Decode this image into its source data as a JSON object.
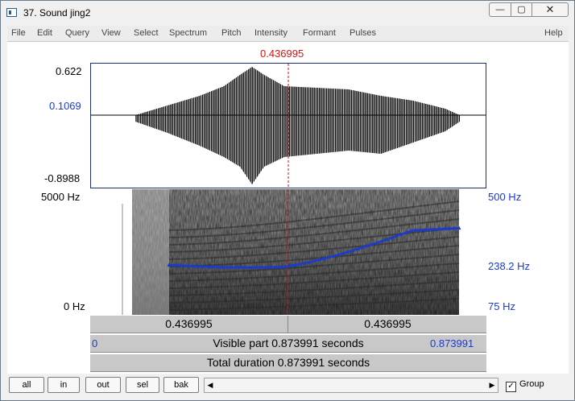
{
  "window": {
    "title": "37. Sound jing2",
    "min_glyph": "—",
    "max_glyph": "▢",
    "close_glyph": "✕"
  },
  "menu": [
    "File",
    "Edit",
    "Query",
    "View",
    "Select",
    "Spectrum",
    "Pitch",
    "Intensity",
    "Formant",
    "Pulses"
  ],
  "menu_help": "Help",
  "cursor": {
    "time": "0.436995"
  },
  "waveform": {
    "max": "0.622",
    "cursor_value": "0.1069",
    "min": "-0.8988"
  },
  "spectrogram": {
    "top_freq": "5000 Hz",
    "bottom_freq": "0 Hz"
  },
  "pitch": {
    "top": "500 Hz",
    "cursor_value": "238.2 Hz",
    "bottom": "75 Hz"
  },
  "bars": {
    "left_half": "0.436995",
    "right_half": "0.436995",
    "visible_start": "0",
    "visible": "Visible part 0.873991 seconds",
    "visible_end": "0.873991",
    "total": "Total duration 0.873991 seconds"
  },
  "toolbar": {
    "all": "all",
    "in": "in",
    "out": "out",
    "sel": "sel",
    "bak": "bak",
    "group": "Group",
    "group_checked": "✓"
  },
  "colors": {
    "pitch": "#1a3ad0",
    "cursor": "#d11111",
    "frame": "#1a2e6e"
  }
}
